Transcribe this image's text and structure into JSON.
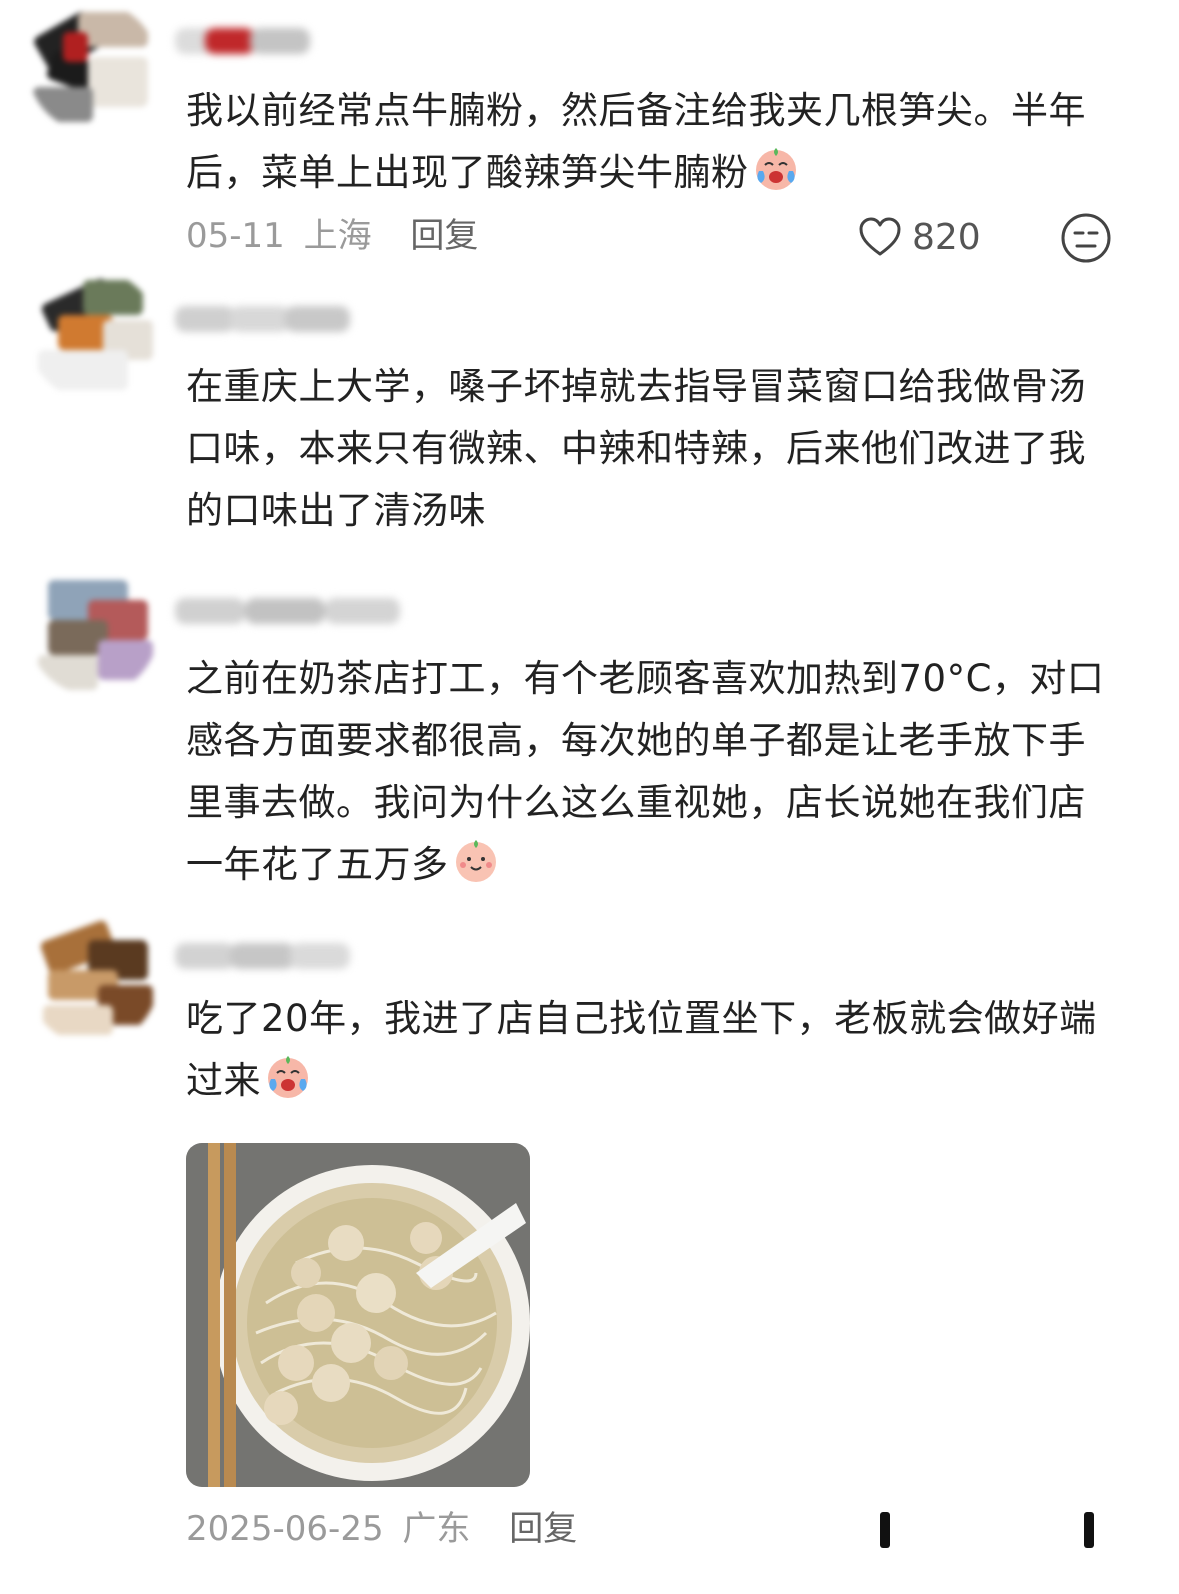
{
  "comments": [
    {
      "text": "我以前经常点牛腩粉，然后备注给我夹几根笋尖。半年后，菜单上出现了酸辣笋尖牛腩粉",
      "emoji": "crying-laughing-emoji",
      "date": "05-11",
      "location": "上海",
      "reply_label": "回复",
      "likes": "820"
    },
    {
      "text": "在重庆上大学，嗓子坏掉就去指导冒菜窗口给我做骨汤口味，本来只有微辣、中辣和特辣，后来他们改进了我的口味出了清汤味"
    },
    {
      "text": "之前在奶茶店打工，有个老顾客喜欢加热到70°C，对口感各方面要求都很高，每次她的单子都是让老手放下手里事去做。我问为什么这么重视她，店长说她在我们店一年花了五万多",
      "emoji": "smiling-peach-emoji"
    },
    {
      "text": "吃了20年，我进了店自己找位置坐下，老板就会做好端过来",
      "emoji": "crying-laughing-emoji",
      "image": "noodle-soup-photo",
      "date": "2025-06-25",
      "location": "广东",
      "reply_label": "回复"
    }
  ],
  "icons": {
    "like": "heart-outline-icon",
    "dislike": "meh-face-icon"
  },
  "colors": {
    "text": "#222222",
    "meta": "#9a9a9a",
    "reply": "#666666"
  }
}
